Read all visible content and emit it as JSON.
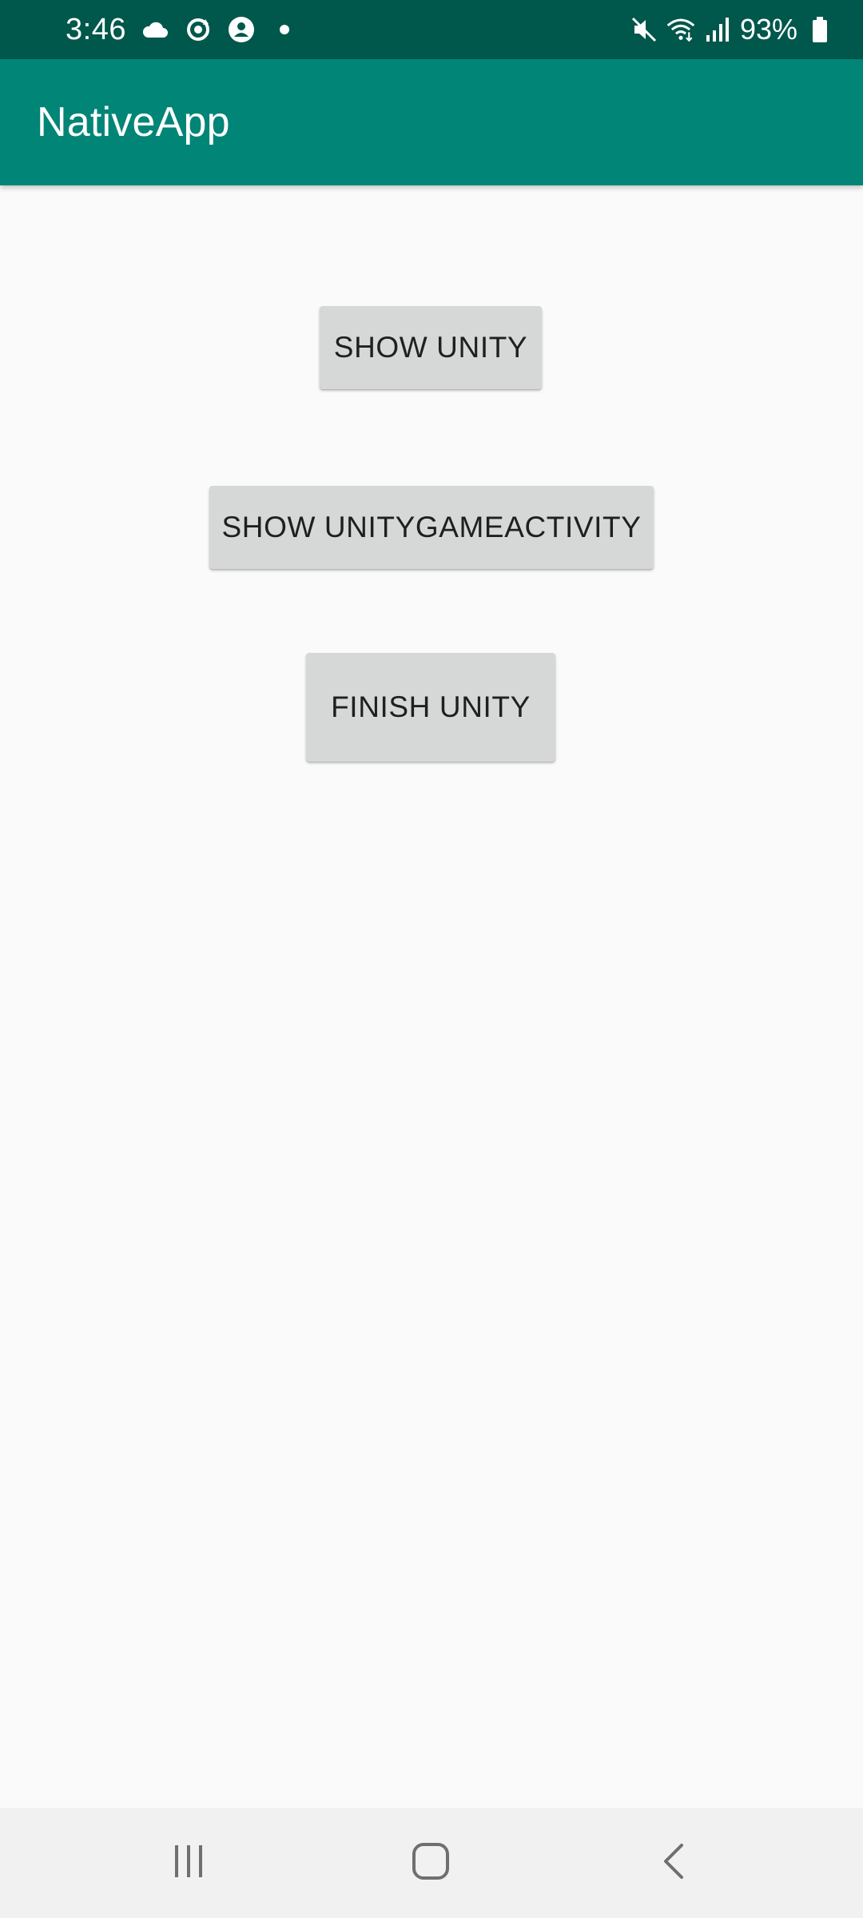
{
  "status_bar": {
    "time": "3:46",
    "battery": "93%",
    "icons_left": [
      "cloud-icon",
      "sync-icon",
      "account-icon",
      "notification-dot-icon"
    ],
    "icons_right": [
      "mute-icon",
      "wifi-icon",
      "signal-icon",
      "battery-icon"
    ],
    "color": "#00574b"
  },
  "app_bar": {
    "title": "NativeApp",
    "color": "#008577"
  },
  "buttons": {
    "show_unity": "SHOW UNITY",
    "show_unity_game_activity": "SHOW UNITYGAMEACTIVITY",
    "finish_unity": "FINISH UNITY"
  },
  "nav_bar": {
    "items": [
      "recent-apps-icon",
      "home-icon",
      "back-icon"
    ]
  }
}
